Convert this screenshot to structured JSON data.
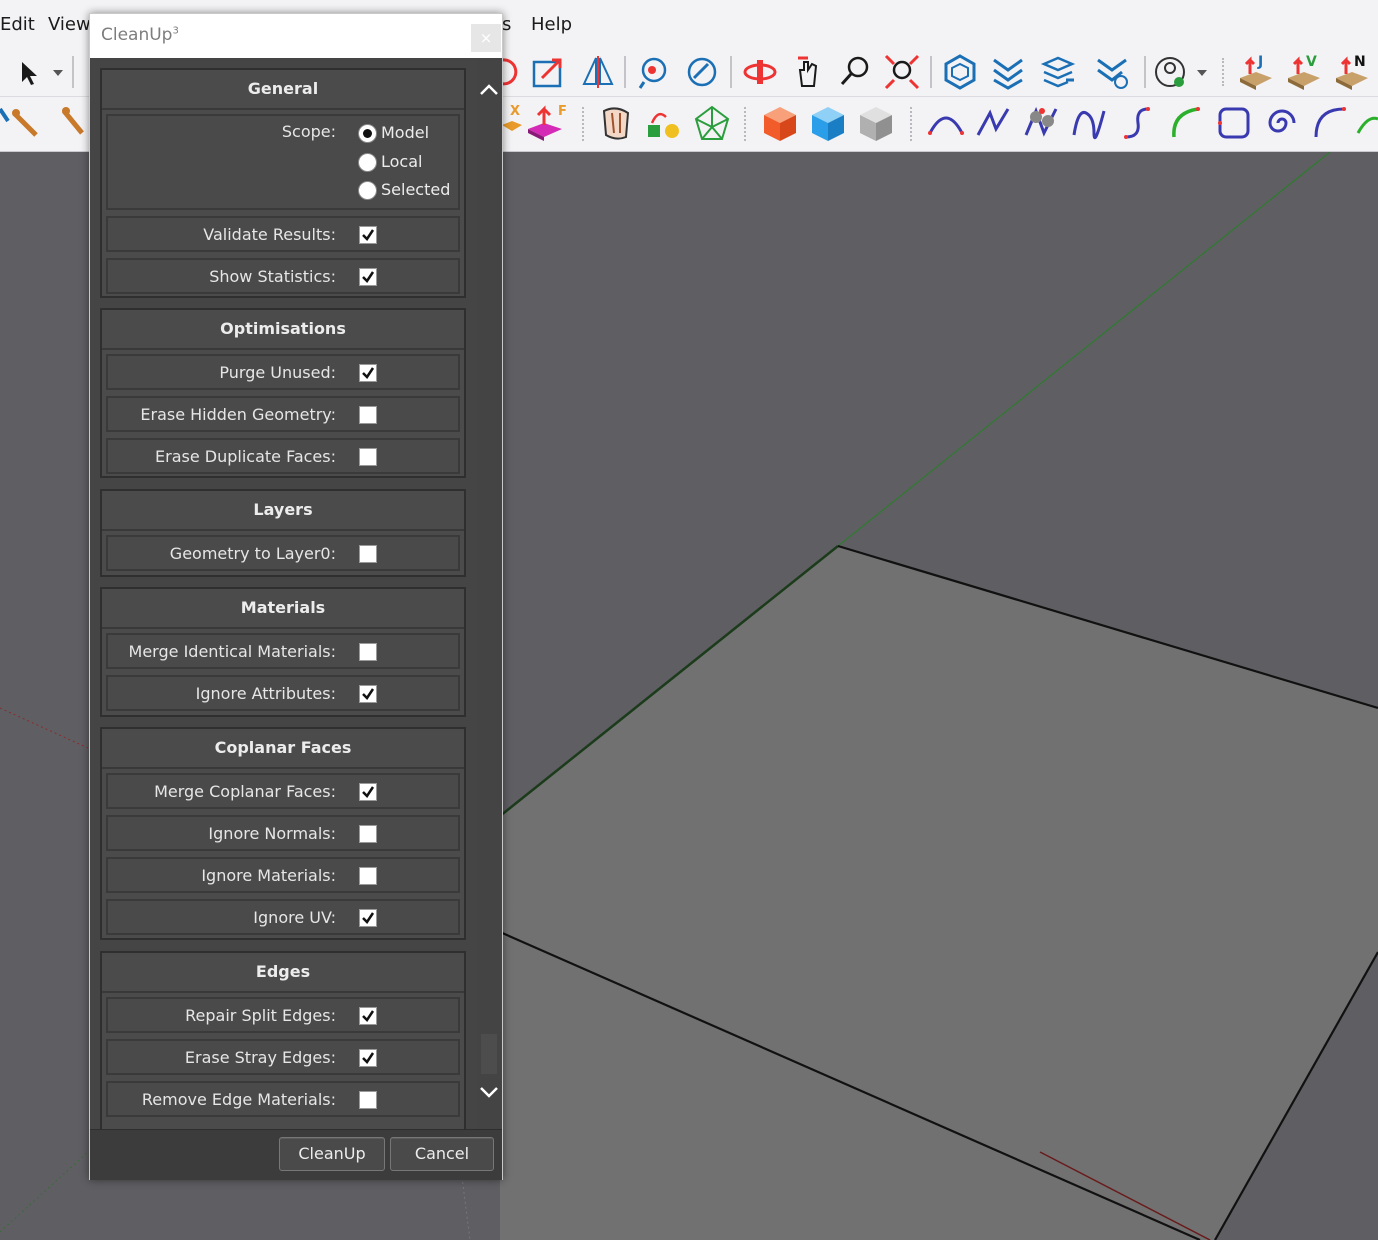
{
  "menubar": {
    "items": [
      "Edit",
      "View",
      "s",
      "Help"
    ]
  },
  "dialog": {
    "title": "CleanUp",
    "title_superscript": "3",
    "close_glyph": "×",
    "sections": {
      "general": {
        "title": "General",
        "scope_label": "Scope:",
        "scope_options": [
          "Model",
          "Local",
          "Selected"
        ],
        "scope_selected": "Model",
        "validate_label": "Validate Results:",
        "validate_checked": true,
        "stats_label": "Show Statistics:",
        "stats_checked": true
      },
      "optimisations": {
        "title": "Optimisations",
        "purge_label": "Purge Unused:",
        "purge_checked": true,
        "erase_hidden_label": "Erase Hidden Geometry:",
        "erase_hidden_checked": false,
        "erase_dup_label": "Erase Duplicate Faces:",
        "erase_dup_checked": false
      },
      "layers": {
        "title": "Layers",
        "geom_layer0_label": "Geometry to Layer0:",
        "geom_layer0_checked": false
      },
      "materials": {
        "title": "Materials",
        "merge_identical_label": "Merge Identical Materials:",
        "merge_identical_checked": false,
        "ignore_attr_label": "Ignore Attributes:",
        "ignore_attr_checked": true
      },
      "coplanar": {
        "title": "Coplanar Faces",
        "merge_coplanar_label": "Merge Coplanar Faces:",
        "merge_coplanar_checked": true,
        "ignore_normals_label": "Ignore Normals:",
        "ignore_normals_checked": false,
        "ignore_materials_label": "Ignore Materials:",
        "ignore_materials_checked": false,
        "ignore_uv_label": "Ignore UV:",
        "ignore_uv_checked": true
      },
      "edges": {
        "title": "Edges",
        "repair_split_label": "Repair Split Edges:",
        "repair_split_checked": true,
        "erase_stray_label": "Erase Stray Edges:",
        "erase_stray_checked": true,
        "remove_edge_mat_label": "Remove Edge Materials:",
        "remove_edge_mat_checked": false
      }
    },
    "buttons": {
      "cleanup": "CleanUp",
      "cancel": "Cancel"
    }
  },
  "toolbar_icons_row1": [
    "select-arrow-icon",
    "dropdown-caret-icon",
    "rotate-icon",
    "scale-box-icon",
    "section-plane-icon",
    "look-around-icon",
    "walk-icon",
    "orbit-icon",
    "pan-hand-icon",
    "zoom-icon",
    "zoom-extents-icon",
    "component-icon",
    "layers-stack-icon",
    "layers-arrow-icon",
    "layers-settings-icon",
    "user-account-icon",
    "dropdown-caret-icon",
    "extension-j-icon",
    "extension-v-icon",
    "extension-n-icon"
  ],
  "toolbar_icons_row2": [
    "tape-icon",
    "paint-icon",
    "push-pull-x-icon",
    "push-pull-f-icon",
    "shell-icon",
    "flag-icon",
    "mesh-icon",
    "cube-orange-icon",
    "cube-blue-icon",
    "cube-gray-icon",
    "arc-curve-icon",
    "zigzag-icon",
    "squiggle-icon",
    "wave-icon",
    "s-curve-icon",
    "green-arc-icon",
    "rounded-rect-icon",
    "spiral-icon",
    "arc-blue-icon",
    "tangent-arc-icon"
  ],
  "colors": {
    "dialog_bg": "#424242",
    "viewport_bg": "#5f5f63",
    "face_gray": "#707070",
    "green_axis": "#2f7a2f",
    "red_axis": "#8a2b2b"
  }
}
